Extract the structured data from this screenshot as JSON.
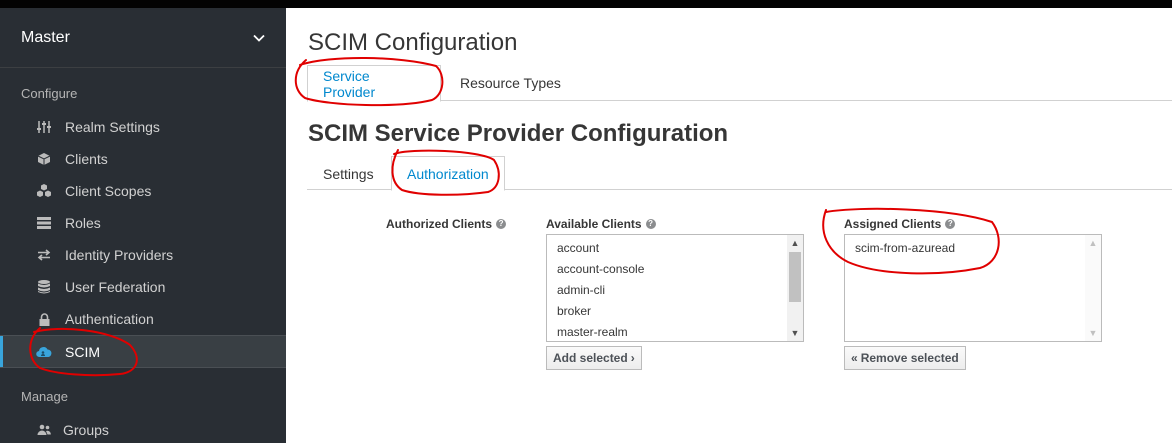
{
  "sidebar": {
    "realm": "Master",
    "configure_title": "Configure",
    "manage_title": "Manage",
    "items": [
      {
        "label": "Realm Settings",
        "icon": "sliders-icon"
      },
      {
        "label": "Clients",
        "icon": "cube-icon"
      },
      {
        "label": "Client Scopes",
        "icon": "cubes-icon"
      },
      {
        "label": "Roles",
        "icon": "list-icon"
      },
      {
        "label": "Identity Providers",
        "icon": "exchange-icon"
      },
      {
        "label": "User Federation",
        "icon": "database-icon"
      },
      {
        "label": "Authentication",
        "icon": "lock-icon"
      },
      {
        "label": "SCIM",
        "icon": "cloud-users-icon"
      }
    ],
    "manage_items": [
      {
        "label": "Groups",
        "icon": "users-icon"
      }
    ]
  },
  "page": {
    "title": "SCIM Configuration",
    "tabs": [
      "Service Provider",
      "Resource Types"
    ],
    "section_title": "SCIM Service Provider Configuration",
    "subtabs": [
      "Settings",
      "Authorization"
    ]
  },
  "form": {
    "authorized_label": "Authorized Clients",
    "available_label": "Available Clients",
    "assigned_label": "Assigned Clients",
    "available": [
      "account",
      "account-console",
      "admin-cli",
      "broker",
      "master-realm"
    ],
    "assigned": [
      "scim-from-azuread"
    ],
    "add_button": "Add selected",
    "remove_button": "Remove selected"
  },
  "colors": {
    "sidebar_bg": "#292e34",
    "accent": "#0088ce",
    "active_marker": "#39a5dc",
    "annotation": "#e00000"
  }
}
